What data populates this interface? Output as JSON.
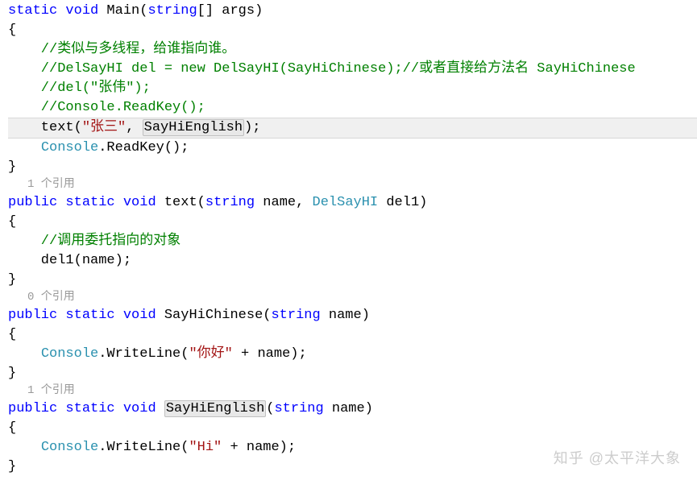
{
  "codelens": {
    "ref1": "1 个引用",
    "ref0": "0 个引用",
    "ref1b": "1 个引用"
  },
  "code": {
    "l1": {
      "kw1": "static",
      "kw2": "void",
      "name": " Main(",
      "kw3": "string",
      "rest": "[] args)"
    },
    "l2": "{",
    "l3": "    //类似与多线程，给谁指向谁。",
    "l4": "    //DelSayHI del = new DelSayHI(SayHiChinese);//或者直接给方法名 SayHiChinese",
    "l5": "    //del(\"张伟\");",
    "l6": "    //Console.ReadKey();",
    "l7": {
      "pre": "    text(",
      "str": "\"张三\"",
      "mid": ", ",
      "sym": "SayHiEnglish",
      "post": ");"
    },
    "l8": {
      "pre": "    ",
      "cls": "Console",
      "post": ".ReadKey();"
    },
    "l9": "}",
    "l10": {
      "kw1": "public",
      "kw2": "static",
      "kw3": "void",
      "name": " text(",
      "kw4": "string",
      "mid": " name, ",
      "type": "DelSayHI",
      "post": " del1)"
    },
    "l11": "{",
    "l12": "    //调用委托指向的对象",
    "l13": "    del1(name);",
    "l14": "}",
    "l15": {
      "kw1": "public",
      "kw2": "static",
      "kw3": "void",
      "name": " SayHiChinese(",
      "kw4": "string",
      "post": " name)"
    },
    "l16": "{",
    "l17": {
      "pre": "    ",
      "cls": "Console",
      "mid": ".WriteLine(",
      "str": "\"你好\"",
      "post": " + name);"
    },
    "l18": "}",
    "l19": {
      "kw1": "public",
      "kw2": "static",
      "kw3": "void",
      "sp": " ",
      "sym": "SayHiEnglish",
      "mid": "(",
      "kw4": "string",
      "post": " name)"
    },
    "l20": "{",
    "l21": {
      "pre": "    ",
      "cls": "Console",
      "mid": ".WriteLine(",
      "str": "\"Hi\"",
      "post": " + name);"
    },
    "l22": "}"
  },
  "watermark": {
    "text": "知乎 @太平洋大象"
  }
}
